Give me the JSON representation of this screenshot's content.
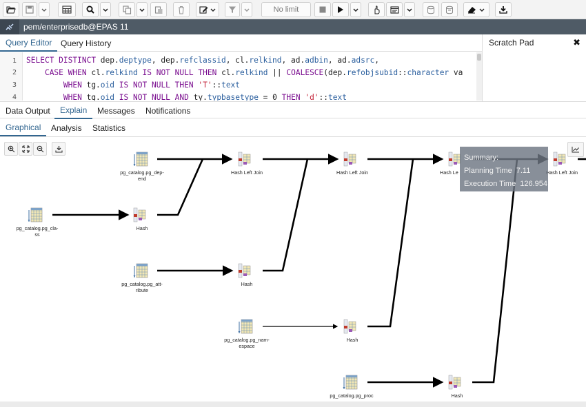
{
  "toolbar": {
    "buttons": [
      "open-file-icon",
      "save-icon",
      "save-options-icon",
      "table-grid-icon",
      "find-icon",
      "copy-icon",
      "paste-icon",
      "delete-icon",
      "edit-icon",
      "filter-icon"
    ],
    "limit_label": "No limit",
    "run_buttons": [
      "stop-icon",
      "execute-icon",
      "explain-icon",
      "explain-options-icon",
      "commit-icon",
      "rollback-icon",
      "clear-icon",
      "download-icon"
    ]
  },
  "connection": {
    "label": "pem/enterprisedb@EPAS 11"
  },
  "editor_tabs": {
    "query_editor": "Query Editor",
    "query_history": "Query History"
  },
  "scratch_pad": {
    "title": "Scratch Pad",
    "close": "✖"
  },
  "code": {
    "line_numbers": [
      "1",
      "2",
      "3",
      "4"
    ],
    "lines": [
      "SELECT DISTINCT dep.deptype, dep.refclassid, cl.relkind, ad.adbin, ad.adsrc,",
      "    CASE WHEN cl.relkind IS NOT NULL THEN cl.relkind || COALESCE(dep.refobjsubid::character va",
      "        WHEN tg.oid IS NOT NULL THEN 'T'::text",
      "        WHEN tg.oid IS NOT NULL AND ty.typbasetype = 0 THEN 'd'::text"
    ]
  },
  "result_tabs": {
    "data_output": "Data Output",
    "explain": "Explain",
    "messages": "Messages",
    "notifications": "Notifications"
  },
  "explain_tabs": {
    "graphical": "Graphical",
    "analysis": "Analysis",
    "statistics": "Statistics"
  },
  "plan_nodes": {
    "pg_depend": [
      "pg_catalog.pg_dep-",
      "end"
    ],
    "pg_class": [
      "pg_catalog.pg_cla-",
      "ss"
    ],
    "pg_attribute": [
      "pg_catalog.pg_att-",
      "ribute"
    ],
    "pg_namespace": [
      "pg_catalog.pg_nam-",
      "espace"
    ],
    "pg_proc": [
      "pg_catalog.pg_proc",
      "..."
    ],
    "hash": "Hash",
    "hash_left_join": "Hash Left Join",
    "hash_left_join_partial": "Hash Le"
  },
  "summary": {
    "title": "Summary:",
    "planning_label": "Planning Time",
    "planning_value": "7.11",
    "execution_label": "Execution Time",
    "execution_value": "126.954"
  },
  "colors": {
    "accent": "#326690",
    "connection_bar": "#4f5b66",
    "keyword": "#7a0d8f",
    "summary_bg": "#6e7682"
  }
}
